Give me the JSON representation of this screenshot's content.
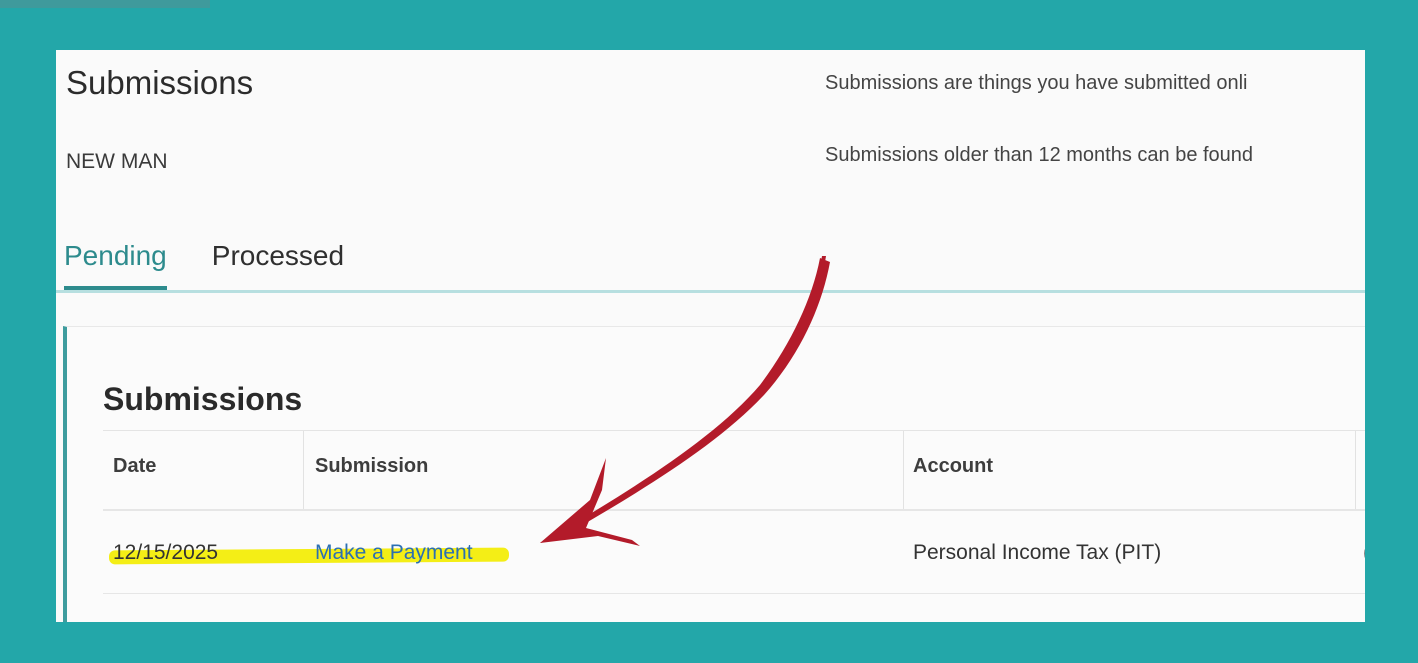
{
  "page": {
    "title": "Submissions",
    "account_name": "NEW MAN",
    "info_line_1": "Submissions are things you have submitted onli",
    "info_line_2": "Submissions older than 12 months can be found"
  },
  "tabs": [
    {
      "label": "Pending",
      "active": true
    },
    {
      "label": "Processed",
      "active": false
    }
  ],
  "card": {
    "title": "Submissions",
    "columns": [
      "Date",
      "Submission",
      "Account"
    ],
    "rows": [
      {
        "date": "12/15/2025",
        "submission": "Make a Payment",
        "account": "Personal Income Tax (PIT)",
        "extra": "("
      }
    ]
  },
  "annotation": {
    "arrow_color": "#b31b2a",
    "highlight_color": "#f4ee16"
  },
  "colors": {
    "background": "#23a7a9",
    "accent": "#2d8b8d",
    "link": "#2b6fb3"
  }
}
